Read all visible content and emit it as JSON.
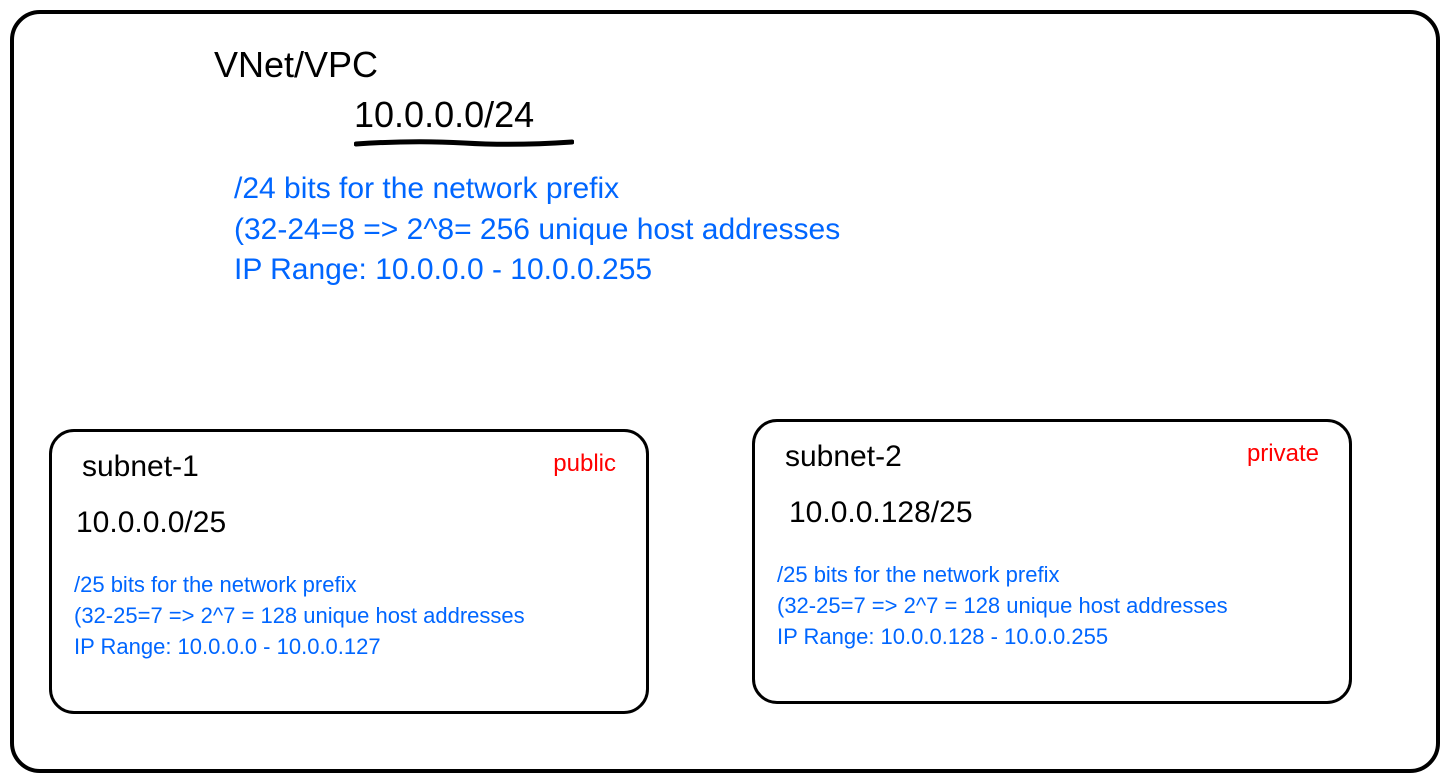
{
  "vpc": {
    "title": "VNet/VPC",
    "cidr": "10.0.0.0/24",
    "note_line1": "/24 bits for the network prefix",
    "note_line2": "(32-24=8 => 2^8= 256 unique host addresses",
    "note_line3": "IP Range: 10.0.0.0 - 10.0.0.255"
  },
  "subnets": [
    {
      "name": "subnet-1",
      "scope": "public",
      "cidr": "10.0.0.0/25",
      "note_line1": "/25 bits for the network prefix",
      "note_line2": "(32-25=7 => 2^7 = 128 unique host addresses",
      "note_line3": "IP Range: 10.0.0.0 - 10.0.0.127"
    },
    {
      "name": "subnet-2",
      "scope": "private",
      "cidr": "10.0.0.128/25",
      "note_line1": "/25 bits for the network prefix",
      "note_line2": "(32-25=7 => 2^7 = 128 unique host addresses",
      "note_line3": "IP Range: 10.0.0.128 - 10.0.0.255"
    }
  ]
}
